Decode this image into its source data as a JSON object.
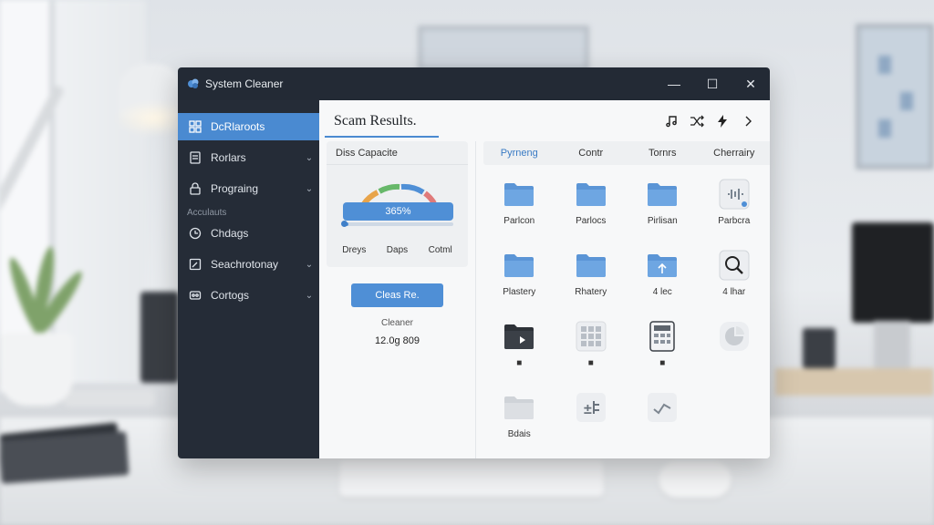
{
  "window": {
    "title": "System Cleaner",
    "minimize": "—",
    "maximize": "☐",
    "close": "✕"
  },
  "sidebar": {
    "items": [
      {
        "label": "DcRlaroots",
        "icon": "grid-icon",
        "has_chevron": false,
        "active": true
      },
      {
        "label": "Rorlars",
        "icon": "document-icon",
        "has_chevron": true
      },
      {
        "label": "Prograing",
        "icon": "lock-icon",
        "has_chevron": true
      }
    ],
    "section_label": "Acculauts",
    "items2": [
      {
        "label": "Chdags",
        "icon": "clock-icon",
        "has_chevron": false
      },
      {
        "label": "Seachrotonay",
        "icon": "edit-icon",
        "has_chevron": true
      },
      {
        "label": "Cortogs",
        "icon": "settings-icon",
        "has_chevron": true
      }
    ]
  },
  "main": {
    "title": "Scam Results.",
    "header_icons": [
      "music-icon",
      "shuffle-icon",
      "bolt-icon",
      "chevron-right-icon"
    ]
  },
  "disk": {
    "header": "Diss Capacite",
    "percent_text": "365%",
    "fill_fraction": 0.05,
    "stats": [
      "Dreys",
      "Daps",
      "Cotml"
    ],
    "gauge_colors": [
      "#e8a44a",
      "#67b86a",
      "#4f8fd6",
      "#e07a7a"
    ]
  },
  "actions": {
    "clean_button": "Cleas Re.",
    "cleaner_label": "Cleaner",
    "cleaner_size": "12.0g 809"
  },
  "tabs": [
    "Pyrneng",
    "Contr",
    "Tornrs",
    "Cherrairy"
  ],
  "grid": [
    {
      "caption": "Parlcon",
      "icon": "folder-icon"
    },
    {
      "caption": "Parlocs",
      "icon": "folder-icon"
    },
    {
      "caption": "Pirlisan",
      "icon": "folder-icon"
    },
    {
      "caption": "Parbcra",
      "icon": "audio-file-icon"
    },
    {
      "caption": "Plastery",
      "icon": "folder-icon"
    },
    {
      "caption": "Rhatery",
      "icon": "folder-icon"
    },
    {
      "caption": "4 lec",
      "icon": "folder-upload-icon"
    },
    {
      "caption": "4 lhar",
      "icon": "search-icon"
    },
    {
      "caption": "■",
      "icon": "dark-folder-icon"
    },
    {
      "caption": "■",
      "icon": "apps-grid-icon"
    },
    {
      "caption": "■",
      "icon": "calculator-icon"
    },
    {
      "caption": "",
      "icon": "pie-chart-icon"
    },
    {
      "caption": "Bdais",
      "icon": "gray-folder-icon"
    },
    {
      "caption": "",
      "icon": "transfer-icon"
    },
    {
      "caption": "",
      "icon": "trend-icon"
    },
    {
      "caption": "",
      "icon": ""
    }
  ]
}
